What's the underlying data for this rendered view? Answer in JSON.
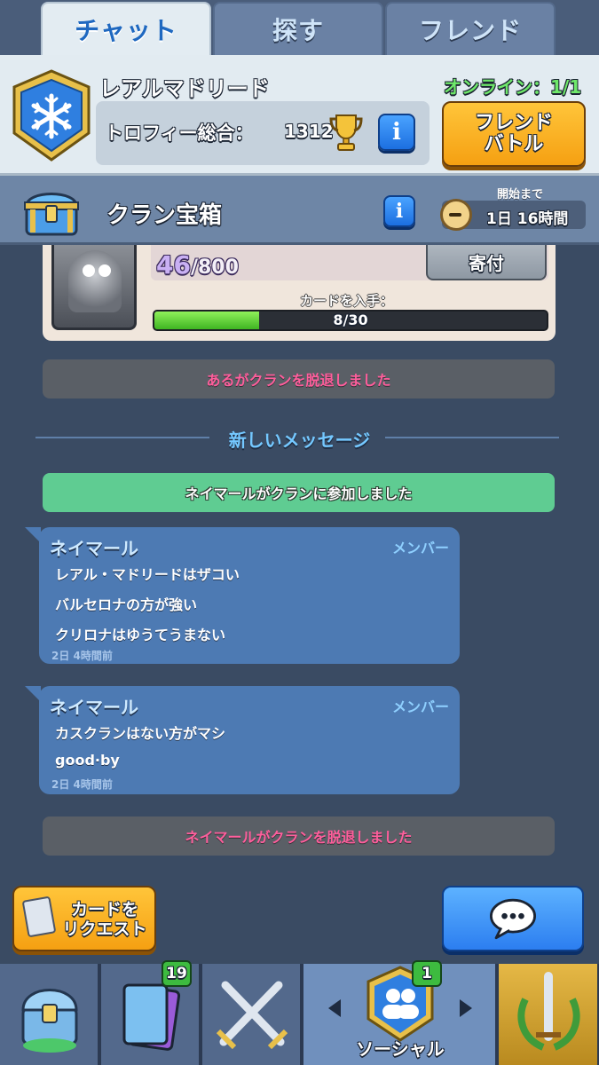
{
  "tabs": [
    {
      "label": "チャット",
      "active": true
    },
    {
      "label": "探す",
      "active": false
    },
    {
      "label": "フレンド",
      "active": false
    }
  ],
  "clan": {
    "name": "レアルマドリード",
    "trophy_label": "トロフィー総合：",
    "trophy_value": "1312",
    "online": "オンライン：1/1",
    "friend_battle_line1": "フレンド",
    "friend_battle_line2": "バトル",
    "badge_icon": "snowflake-icon"
  },
  "chest": {
    "title": "クラン宝箱",
    "timer_label": "開始まで",
    "timer_value": "1日 16時間"
  },
  "request": {
    "donated": "46",
    "donate_total": "/800",
    "donate_button": "寄付",
    "cards_label": "カードを入手：",
    "cards_progress": "8/30",
    "cards_fraction": 0.267
  },
  "feed": {
    "leave1": "あるがクランを脱退しました",
    "new_messages": "新しいメッセージ",
    "join": "ネイマールがクランに参加しました",
    "message1": {
      "sender": "ネイマール",
      "role": "メンバー",
      "lines": [
        "レアル・マドリードはザコい",
        "バルセロナの方が強い",
        "クリロナはゆうてうまない"
      ],
      "time": "2日 4時間前"
    },
    "message2": {
      "sender": "ネイマール",
      "role": "メンバー",
      "lines": [
        "カスクランはない方がマシ",
        "good·by"
      ],
      "time": "2日 4時間前"
    },
    "leave2": "ネイマールがクランを脱退しました"
  },
  "actions": {
    "request_line1": "カードを",
    "request_line2": "リクエスト",
    "chat_icon": "speech-bubble-icon"
  },
  "nav": {
    "cards_badge": "19",
    "social_badge": "1",
    "social_label": "ソーシャル",
    "items": [
      "shop-chest-icon",
      "cards-icon",
      "battle-swords-icon",
      "social-icon",
      "tournament-icon"
    ]
  },
  "colors": {
    "background": "#3a4b63",
    "accent_gold": "#f5a012",
    "accent_blue": "#2c7ef0",
    "leave_text": "#ff5e9c",
    "join_bg": "#5fcc92"
  }
}
